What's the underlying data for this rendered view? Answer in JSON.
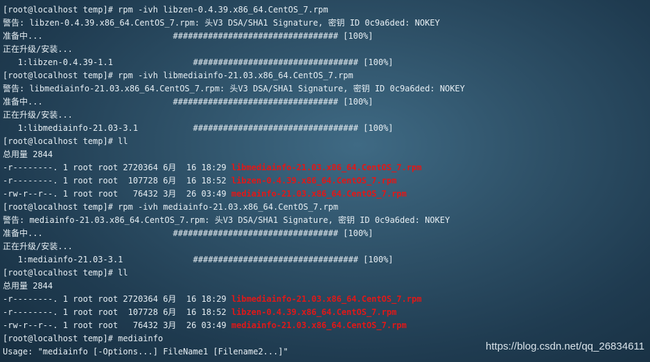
{
  "terminal": {
    "lines": [
      {
        "text": "[root@localhost temp]# rpm -ivh libzen-0.4.39.x86_64.CentOS_7.rpm",
        "highlight": ""
      },
      {
        "text": "警告: libzen-0.4.39.x86_64.CentOS_7.rpm: 头V3 DSA/SHA1 Signature, 密钥 ID 0c9a6ded: NOKEY",
        "highlight": ""
      },
      {
        "text": "准备中...                          ################################# [100%]",
        "highlight": ""
      },
      {
        "text": "正在升级/安装...",
        "highlight": ""
      },
      {
        "text": "   1:libzen-0.4.39-1.1                ################################# [100%]",
        "highlight": ""
      },
      {
        "text": "[root@localhost temp]# rpm -ivh libmediainfo-21.03.x86_64.CentOS_7.rpm",
        "highlight": ""
      },
      {
        "text": "警告: libmediainfo-21.03.x86_64.CentOS_7.rpm: 头V3 DSA/SHA1 Signature, 密钥 ID 0c9a6ded: NOKEY",
        "highlight": ""
      },
      {
        "text": "准备中...                          ################################# [100%]",
        "highlight": ""
      },
      {
        "text": "正在升级/安装...",
        "highlight": ""
      },
      {
        "text": "   1:libmediainfo-21.03-3.1           ################################# [100%]",
        "highlight": ""
      },
      {
        "text": "[root@localhost temp]# ll",
        "highlight": ""
      },
      {
        "text": "总用量 2844",
        "highlight": ""
      },
      {
        "text": "-r--------. 1 root root 2720364 6月  16 18:29 ",
        "highlight": "libmediainfo-21.03.x86_64.CentOS_7.rpm"
      },
      {
        "text": "-r--------. 1 root root  107728 6月  16 18:52 ",
        "highlight": "libzen-0.4.39.x86_64.CentOS_7.rpm"
      },
      {
        "text": "-rw-r--r--. 1 root root   76432 3月  26 03:49 ",
        "highlight": "mediainfo-21.03.x86_64.CentOS_7.rpm"
      },
      {
        "text": "[root@localhost temp]# rpm -ivh mediainfo-21.03.x86_64.CentOS_7.rpm",
        "highlight": ""
      },
      {
        "text": "警告: mediainfo-21.03.x86_64.CentOS_7.rpm: 头V3 DSA/SHA1 Signature, 密钥 ID 0c9a6ded: NOKEY",
        "highlight": ""
      },
      {
        "text": "准备中...                          ################################# [100%]",
        "highlight": ""
      },
      {
        "text": "正在升级/安装...",
        "highlight": ""
      },
      {
        "text": "   1:mediainfo-21.03-3.1              ################################# [100%]",
        "highlight": ""
      },
      {
        "text": "[root@localhost temp]# ll",
        "highlight": ""
      },
      {
        "text": "总用量 2844",
        "highlight": ""
      },
      {
        "text": "-r--------. 1 root root 2720364 6月  16 18:29 ",
        "highlight": "libmediainfo-21.03.x86_64.CentOS_7.rpm"
      },
      {
        "text": "-r--------. 1 root root  107728 6月  16 18:52 ",
        "highlight": "libzen-0.4.39.x86_64.CentOS_7.rpm"
      },
      {
        "text": "-rw-r--r--. 1 root root   76432 3月  26 03:49 ",
        "highlight": "mediainfo-21.03.x86_64.CentOS_7.rpm"
      },
      {
        "text": "[root@localhost temp]# mediainfo",
        "highlight": ""
      },
      {
        "text": "Usage: \"mediainfo [-Options...] FileName1 [Filename2...]\"",
        "highlight": ""
      }
    ]
  },
  "watermark": "https://blog.csdn.net/qq_26834611",
  "colors": {
    "background": "#2f5269",
    "text": "#e6eef3",
    "highlight": "#e01818"
  }
}
